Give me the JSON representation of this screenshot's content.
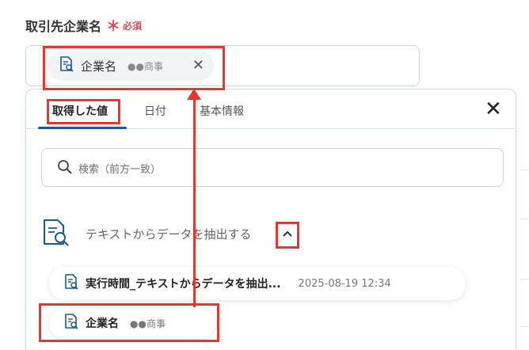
{
  "field": {
    "label": "取引先企業名",
    "required_mark": "＊",
    "required_text": "必須"
  },
  "chip": {
    "name": "企業名",
    "value": "●●商事",
    "remove_icon": "close-icon"
  },
  "panel": {
    "tabs": [
      {
        "label": "取得した値",
        "active": true
      },
      {
        "label": "日付",
        "active": false
      },
      {
        "label": "基本情報",
        "active": false
      }
    ],
    "close_icon": "close-icon",
    "search": {
      "placeholder": "検索（前方一致）",
      "icon": "search-icon"
    },
    "group": {
      "title": "テキストからデータを抽出する",
      "icon": "document-search-icon",
      "toggle_icon": "chevron-up-icon"
    },
    "items": [
      {
        "name": "実行時間_テキストからデータを抽出...",
        "date": "2025-08-19 12:34"
      },
      {
        "name": "企業名",
        "value": "●●商事"
      }
    ]
  },
  "colors": {
    "accent": "#1c5c8a",
    "required": "#e5484d",
    "annotation": "#e8362e"
  }
}
